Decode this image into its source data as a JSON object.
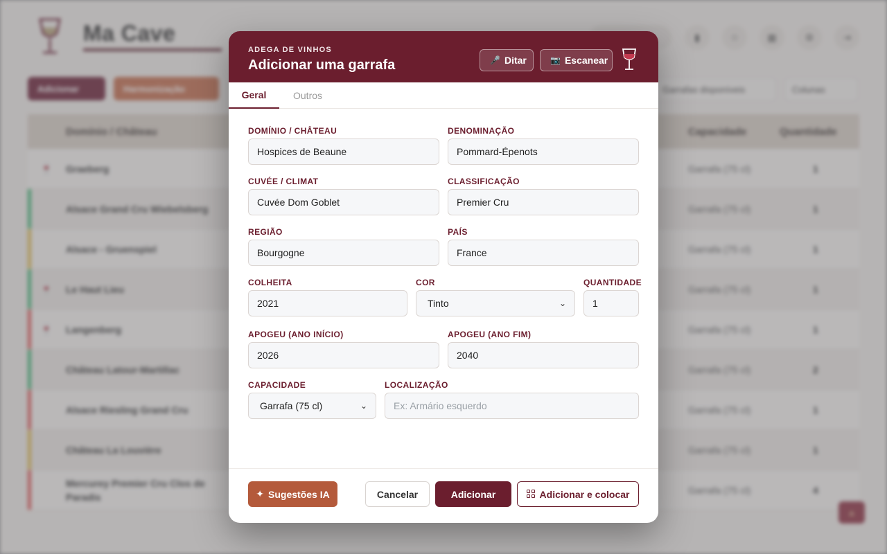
{
  "background": {
    "app_title": "Ma Cave",
    "toolbar": {
      "add_label": "Adicionar",
      "harmonize_label": "Harmonização"
    },
    "filters": {
      "available_label": "Garrafas disponíveis",
      "columns_label": "Colunas"
    },
    "table": {
      "headers": [
        "Domínio / Château",
        "Capacidade",
        "Quantidade"
      ],
      "rows": [
        {
          "name": "Graeberg",
          "capacity": "Garrafa (75 cl)",
          "qty": "1",
          "stripe": "",
          "glass": true
        },
        {
          "name": "Alsace Grand Cru Wiebelsberg",
          "capacity": "Garrafa (75 cl)",
          "qty": "1",
          "stripe": "#3cb371",
          "glass": false
        },
        {
          "name": "Alsace - Gruenspiel",
          "capacity": "Garrafa (75 cl)",
          "qty": "1",
          "stripe": "#e0b84a",
          "glass": false
        },
        {
          "name": "Le Haut Lieu",
          "capacity": "Garrafa (75 cl)",
          "qty": "1",
          "stripe": "#3cb371",
          "glass": true
        },
        {
          "name": "Langenberg",
          "capacity": "Garrafa (75 cl)",
          "qty": "1",
          "stripe": "#e05252",
          "glass": true
        },
        {
          "name": "Château Latour-Martillac",
          "capacity": "Garrafa (75 cl)",
          "qty": "2",
          "stripe": "#3cb371",
          "glass": false
        },
        {
          "name": "Alsace Riesling Grand Cru",
          "capacity": "Garrafa (75 cl)",
          "qty": "1",
          "stripe": "#e05252",
          "glass": false
        },
        {
          "name": "Château La Louvière",
          "capacity": "Garrafa (75 cl)",
          "qty": "1",
          "stripe": "#e0b84a",
          "glass": false
        },
        {
          "name": "Mercurey Premier Cru Clos de Paradis",
          "capacity": "Garrafa (75 cl)",
          "qty": "4",
          "stripe": "#e05252",
          "glass": false
        }
      ]
    }
  },
  "modal": {
    "kicker": "ADEGA DE VINHOS",
    "title": "Adicionar uma garrafa",
    "dictate_label": "Ditar",
    "scan_label": "Escanear",
    "tabs": {
      "general": "Geral",
      "others": "Outros"
    },
    "fields": {
      "domain": {
        "label": "DOMÍNIO / CHÂTEAU",
        "value": "Hospices de Beaune"
      },
      "denomination": {
        "label": "DENOMINAÇÃO",
        "value": "Pommard-Épenots"
      },
      "cuvee": {
        "label": "CUVÉE / CLIMAT",
        "value": "Cuvée Dom Goblet"
      },
      "classification": {
        "label": "CLASSIFICAÇÃO",
        "value": "Premier Cru"
      },
      "region": {
        "label": "REGIÃO",
        "value": "Bourgogne"
      },
      "country": {
        "label": "PAÍS",
        "value": "France"
      },
      "vintage": {
        "label": "COLHEITA",
        "value": "2021"
      },
      "color": {
        "label": "COR",
        "value": "Tinto"
      },
      "quantity": {
        "label": "QUANTIDADE",
        "value": "1"
      },
      "peak_start": {
        "label": "APOGEU (ANO INÍCIO)",
        "value": "2026"
      },
      "peak_end": {
        "label": "APOGEU (ANO FIM)",
        "value": "2040"
      },
      "capacity": {
        "label": "CAPACIDADE",
        "value": "Garrafa (75 cl)"
      },
      "location": {
        "label": "LOCALIZAÇÃO",
        "placeholder": "Ex: Armário esquerdo"
      }
    },
    "footer": {
      "ai_label": "Sugestões IA",
      "cancel_label": "Cancelar",
      "add_label": "Adicionar",
      "add_place_label": "Adicionar e colocar"
    }
  },
  "colors": {
    "wine": "#6b1e2e",
    "copper": "#b45a3b"
  }
}
